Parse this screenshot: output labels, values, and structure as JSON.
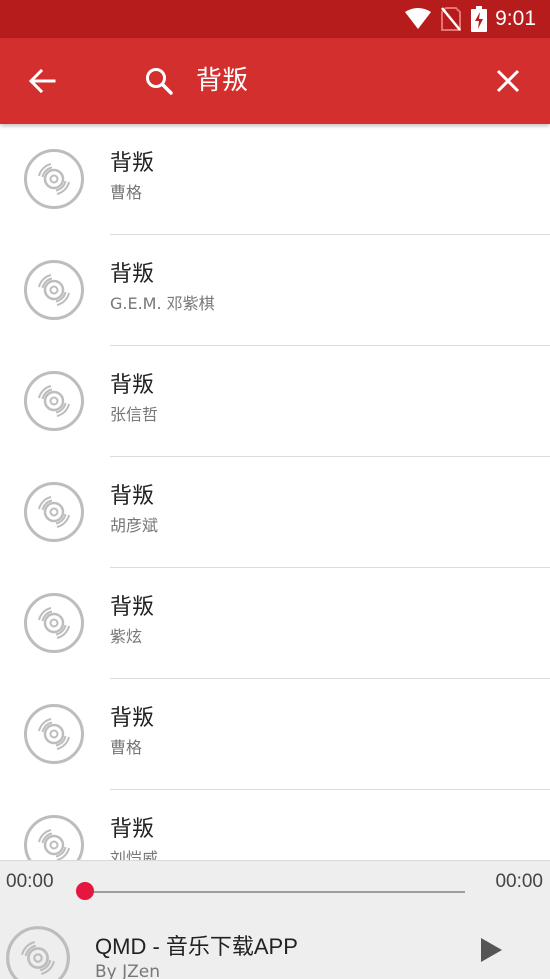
{
  "status_bar": {
    "time": "9:01",
    "icons": [
      "wifi-icon",
      "no-sim-icon",
      "battery-charging-icon"
    ]
  },
  "search_bar": {
    "query": "背叛",
    "icons": [
      "back-arrow-icon",
      "search-icon",
      "close-icon"
    ]
  },
  "results": [
    {
      "title": "背叛",
      "artist": "曹格"
    },
    {
      "title": "背叛",
      "artist": "G.E.M. 邓紫棋"
    },
    {
      "title": "背叛",
      "artist": "张信哲"
    },
    {
      "title": "背叛",
      "artist": "胡彦斌"
    },
    {
      "title": "背叛",
      "artist": "紫炫"
    },
    {
      "title": "背叛",
      "artist": "曹格"
    },
    {
      "title": "背叛",
      "artist": "刘恺威"
    }
  ],
  "player": {
    "elapsed": "00:00",
    "duration": "00:00",
    "progress": 0,
    "song_title": "QMD - 音乐下载APP",
    "song_subtitle": "By JZen",
    "accent_color": "#e5173f"
  },
  "colors": {
    "status_bar": "#b71c1c",
    "app_bar": "#d32f2f"
  }
}
